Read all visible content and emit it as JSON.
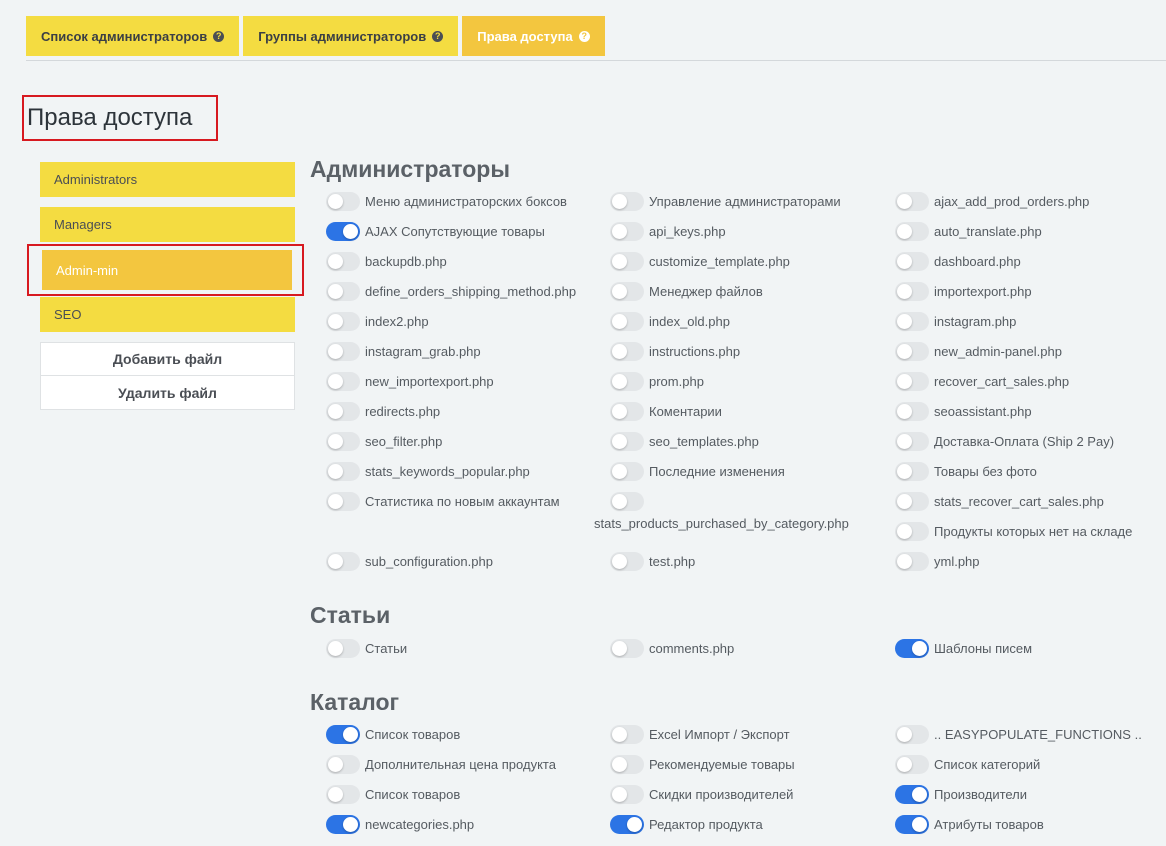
{
  "tabs": [
    {
      "label": "Список администраторов",
      "active": false
    },
    {
      "label": "Группы администраторов",
      "active": false
    },
    {
      "label": "Права доступа",
      "active": true
    }
  ],
  "page_title": "Права доступа",
  "sidebar": {
    "groups": [
      "Administrators",
      "Managers",
      "Admin-min",
      "SEO"
    ],
    "selected": "Admin-min",
    "add_file": "Добавить файл",
    "delete_file": "Удалить файл"
  },
  "sections": [
    {
      "title": "Администраторы",
      "items": [
        {
          "label": "Меню администраторских боксов",
          "on": false
        },
        {
          "label": "Управление администраторами",
          "on": false
        },
        {
          "label": "ajax_add_prod_orders.php",
          "on": false
        },
        {
          "label": "AJAX Сопутствующие товары",
          "on": true
        },
        {
          "label": "api_keys.php",
          "on": false
        },
        {
          "label": "auto_translate.php",
          "on": false
        },
        {
          "label": "backupdb.php",
          "on": false
        },
        {
          "label": "customize_template.php",
          "on": false
        },
        {
          "label": "dashboard.php",
          "on": false
        },
        {
          "label": "define_orders_shipping_method.php",
          "on": false
        },
        {
          "label": "Менеджер файлов",
          "on": false
        },
        {
          "label": "importexport.php",
          "on": false
        },
        {
          "label": "index2.php",
          "on": false
        },
        {
          "label": "index_old.php",
          "on": false
        },
        {
          "label": "instagram.php",
          "on": false
        },
        {
          "label": "instagram_grab.php",
          "on": false
        },
        {
          "label": "instructions.php",
          "on": false
        },
        {
          "label": "new_admin-panel.php",
          "on": false
        },
        {
          "label": "new_importexport.php",
          "on": false
        },
        {
          "label": "prom.php",
          "on": false
        },
        {
          "label": "recover_cart_sales.php",
          "on": false
        },
        {
          "label": "redirects.php",
          "on": false
        },
        {
          "label": "Коментарии",
          "on": false
        },
        {
          "label": "seoassistant.php",
          "on": false
        },
        {
          "label": "seo_filter.php",
          "on": false
        },
        {
          "label": "seo_templates.php",
          "on": false
        },
        {
          "label": "Доставка-Оплата (Ship 2 Pay)",
          "on": false
        },
        {
          "label": "stats_keywords_popular.php",
          "on": false
        },
        {
          "label": "Последние изменения",
          "on": false
        },
        {
          "label": "Товары без фото",
          "on": false
        },
        {
          "label": "Статистика по новым аккаунтам",
          "on": false
        },
        {
          "label": "stats_products_purchased_by_category.php",
          "on": false
        },
        {
          "label": "stats_recover_cart_sales.php",
          "on": false
        },
        {
          "label": "Продукты которых нет на складе",
          "on": false
        },
        {
          "label": "sub_configuration.php",
          "on": false
        },
        {
          "label": "test.php",
          "on": false
        },
        {
          "label": "yml.php",
          "on": false
        }
      ]
    },
    {
      "title": "Статьи",
      "items": [
        {
          "label": "Статьи",
          "on": false
        },
        {
          "label": "comments.php",
          "on": false
        },
        {
          "label": "Шаблоны писем",
          "on": true
        }
      ]
    },
    {
      "title": "Каталог",
      "items": [
        {
          "label": "Список товаров",
          "on": true
        },
        {
          "label": "Excel Импорт / Экспорт",
          "on": false
        },
        {
          "label": ".. EASYPOPULATE_FUNCTIONS ..",
          "on": false
        },
        {
          "label": "Дополнительная цена продукта",
          "on": false
        },
        {
          "label": "Рекомендуемые товары",
          "on": false
        },
        {
          "label": "Список категорий",
          "on": false
        },
        {
          "label": "Список товаров",
          "on": false
        },
        {
          "label": "Скидки производителей",
          "on": false
        },
        {
          "label": "Производители",
          "on": true
        },
        {
          "label": "newcategories.php",
          "on": true
        },
        {
          "label": "Редактор продукта",
          "on": true
        },
        {
          "label": "Атрибуты товаров",
          "on": true
        }
      ]
    }
  ],
  "colors": {
    "yellow": "#f4dc41",
    "active_yellow": "#f3c63f",
    "toggle_on": "#2c74e5",
    "highlight": "#d71920"
  }
}
